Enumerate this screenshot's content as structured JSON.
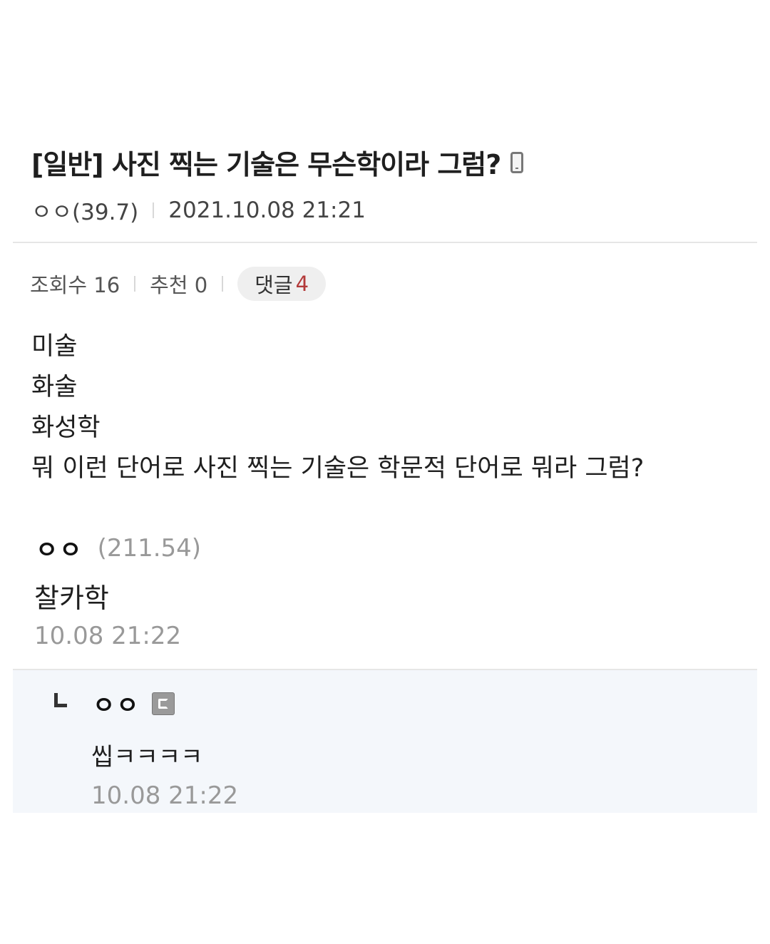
{
  "post": {
    "title": "[일반] 사진 찍는 기술은 무슨학이라 그럼?",
    "device_icon": "mobile-phone-icon",
    "author": "ㅇㅇ(39.7)",
    "datetime": "2021.10.08 21:21",
    "views_label": "조회수 16",
    "recommend_label": "추천 0",
    "comments_label": "댓글",
    "comments_count": "4",
    "body_lines": [
      "미술",
      "화술",
      "화성학",
      "뭐 이런 단어로 사진 찍는 기술은 학문적 단어로 뭐라 그럼?"
    ]
  },
  "comments": [
    {
      "author": "ㅇㅇ",
      "ip": "(211.54)",
      "text": "찰카학",
      "datetime": "10.08 21:22"
    }
  ],
  "reply": {
    "author": "ㅇㅇ",
    "badge_icon": "gallog-icon",
    "text": "씹ㅋㅋㅋㅋ",
    "datetime": "10.08 21:22"
  },
  "colors": {
    "comment_count": "#b33a3a",
    "reply_bg": "#f4f7fb",
    "muted_text": "#999999"
  }
}
